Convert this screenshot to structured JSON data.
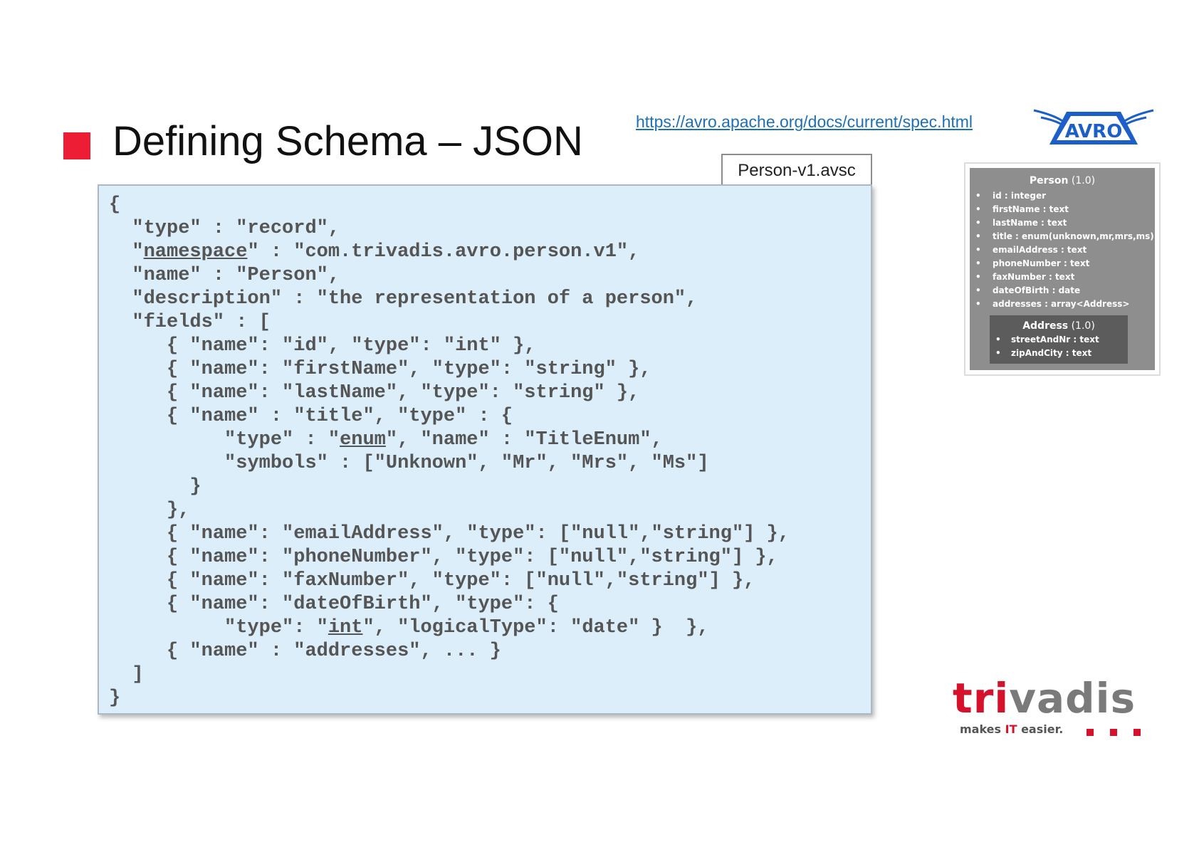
{
  "slide": {
    "title": "Defining Schema – JSON",
    "spec_link": "https://avro.apache.org/docs/current/spec.html",
    "accent_color": "#ee1d36"
  },
  "avro_logo": {
    "text": "AVRO",
    "color": "#1d5fc8"
  },
  "file_tab": {
    "label": "Person-v1.avsc"
  },
  "code": {
    "lines": [
      "{",
      "  \"type\" : \"record\",",
      "  \"namespace\" : \"com.trivadis.avro.person.v1\",",
      "  \"name\" : \"Person\",",
      "  \"description\" : \"the representation of a person\",",
      "  \"fields\" : [",
      "     { \"name\": \"id\", \"type\": \"int\" },",
      "     { \"name\": \"firstName\", \"type\": \"string\" },",
      "     { \"name\": \"lastName\", \"type\": \"string\" },",
      "     { \"name\" : \"title\", \"type\" : {",
      "          \"type\" : \"enum\", \"name\" : \"TitleEnum\",",
      "          \"symbols\" : [\"Unknown\", \"Mr\", \"Mrs\", \"Ms\"]",
      "       }",
      "     },",
      "     { \"name\": \"emailAddress\", \"type\": [\"null\",\"string\"] },",
      "     { \"name\": \"phoneNumber\", \"type\": [\"null\",\"string\"] },",
      "     { \"name\": \"faxNumber\", \"type\": [\"null\",\"string\"] },",
      "     { \"name\": \"dateOfBirth\", \"type\": {",
      "          \"type\": \"int\", \"logicalType\": \"date\" }  },",
      "     { \"name\" : \"addresses\", ... }",
      "  ]",
      "}"
    ],
    "underlined_words": [
      "namespace",
      "enum",
      "int"
    ],
    "underline_line_indexes": [
      2,
      10,
      18
    ]
  },
  "person_entity": {
    "name": "Person",
    "version": "(1.0)",
    "fields": [
      "id : integer",
      "firstName : text",
      "lastName : text",
      "title : enum(unknown,mr,mrs,ms)",
      "emailAddress : text",
      "phoneNumber : text",
      "faxNumber : text",
      "dateOfBirth : date",
      "addresses : array<Address>"
    ],
    "address": {
      "name": "Address",
      "version": "(1.0)",
      "fields": [
        "streetAndNr : text",
        "zipAndCity : text"
      ]
    }
  },
  "trivadis_logo": {
    "word_red_part": "tri",
    "word_gray_part": "vadis",
    "tagline_before": "makes ",
    "tagline_highlight": "IT",
    "tagline_after": " easier."
  }
}
